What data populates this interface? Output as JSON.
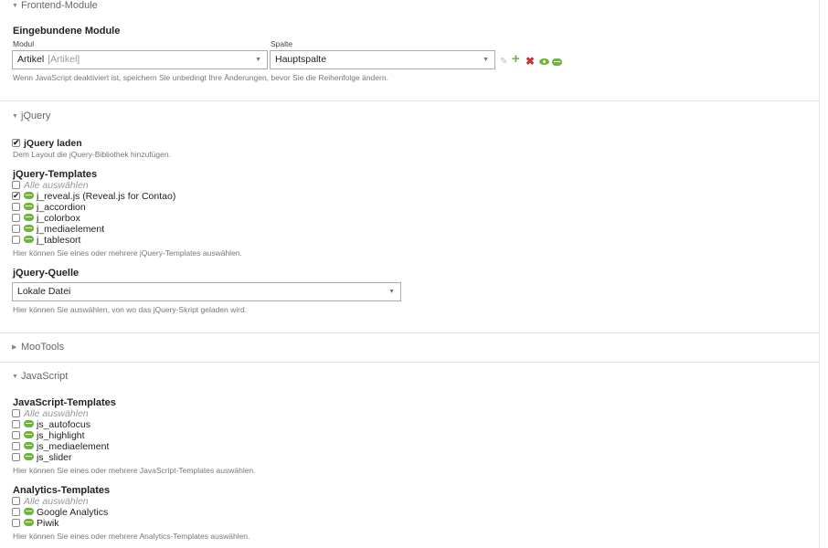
{
  "colors": {
    "accent_green": "#6eb43f",
    "delete_red": "#cc3333",
    "border": "#e3e3e3"
  },
  "frontend": {
    "legend": "Frontend-Module",
    "heading": "Eingebundene Module",
    "modul_label": "Modul",
    "spalte_label": "Spalte",
    "modul_value": "Artikel",
    "modul_hint": "[Artikel]",
    "spalte_value": "Hauptspalte",
    "tip": "Wenn JavaScript deaktiviert ist, speichern Sie unbedingt Ihre Änderungen, bevor Sie die Reihenfolge ändern.",
    "icons": [
      "edit-icon",
      "add-icon",
      "delete-icon",
      "toggle-visibility-icon",
      "drag-handle-icon"
    ]
  },
  "jquery": {
    "legend": "jQuery",
    "load_label": "jQuery laden",
    "load_checked": true,
    "load_tip": "Dem Layout die jQuery-Bibliothek hinzufügen.",
    "templates_heading": "jQuery-Templates",
    "select_all": "Alle auswählen",
    "templates": [
      {
        "label": "j_reveal.js (Reveal.js for Contao)",
        "checked": true
      },
      {
        "label": "j_accordion",
        "checked": false
      },
      {
        "label": "j_colorbox",
        "checked": false
      },
      {
        "label": "j_mediaelement",
        "checked": false
      },
      {
        "label": "j_tablesort",
        "checked": false
      }
    ],
    "templates_tip": "Hier können Sie eines oder mehrere jQuery-Templates auswählen.",
    "source_heading": "jQuery-Quelle",
    "source_value": "Lokale Datei",
    "source_tip": "Hier können Sie auswählen, von wo das jQuery-Skript geladen wird."
  },
  "mootools": {
    "legend": "MooTools"
  },
  "javascript": {
    "legend": "JavaScript",
    "js_heading": "JavaScript-Templates",
    "select_all": "Alle auswählen",
    "js_templates": [
      {
        "label": "js_autofocus",
        "checked": false
      },
      {
        "label": "js_highlight",
        "checked": false
      },
      {
        "label": "js_mediaelement",
        "checked": false
      },
      {
        "label": "js_slider",
        "checked": false
      }
    ],
    "js_tip": "Hier können Sie eines oder mehrere JavaScript-Templates auswählen.",
    "analytics_heading": "Analytics-Templates",
    "analytics_templates": [
      {
        "label": "Google Analytics",
        "checked": false
      },
      {
        "label": "Piwik",
        "checked": false
      }
    ],
    "analytics_tip": "Hier können Sie eines oder mehrere Analytics-Templates auswählen."
  }
}
